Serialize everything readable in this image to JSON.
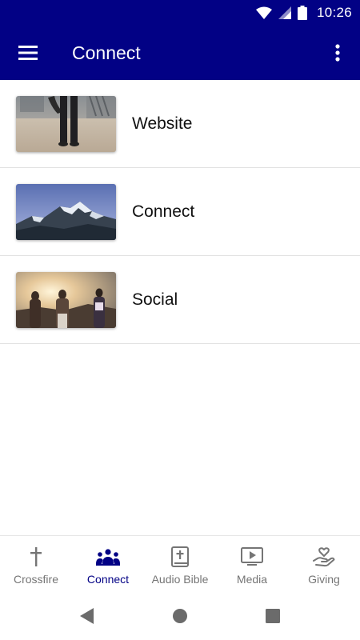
{
  "status_bar": {
    "time": "10:26",
    "icons": [
      "wifi-icon",
      "signal-icon",
      "battery-icon"
    ]
  },
  "app_bar": {
    "title": "Connect",
    "left_icon": "menu-icon",
    "right_icon": "more-vert-icon",
    "background": "#020185"
  },
  "list": {
    "items": [
      {
        "label": "Website",
        "thumbnail": "street-legs-photo"
      },
      {
        "label": "Connect",
        "thumbnail": "mountain-photo"
      },
      {
        "label": "Social",
        "thumbnail": "friends-sunset-photo"
      }
    ]
  },
  "bottom_nav": {
    "active_index": 1,
    "active_color": "#020185",
    "inactive_color": "#757575",
    "items": [
      {
        "label": "Crossfire",
        "icon": "cross-icon"
      },
      {
        "label": "Connect",
        "icon": "people-icon"
      },
      {
        "label": "Audio Bible",
        "icon": "bible-icon"
      },
      {
        "label": "Media",
        "icon": "video-icon"
      },
      {
        "label": "Giving",
        "icon": "giving-hand-icon"
      }
    ]
  },
  "system_nav": {
    "buttons": [
      "back-icon",
      "home-icon",
      "recents-icon"
    ]
  }
}
